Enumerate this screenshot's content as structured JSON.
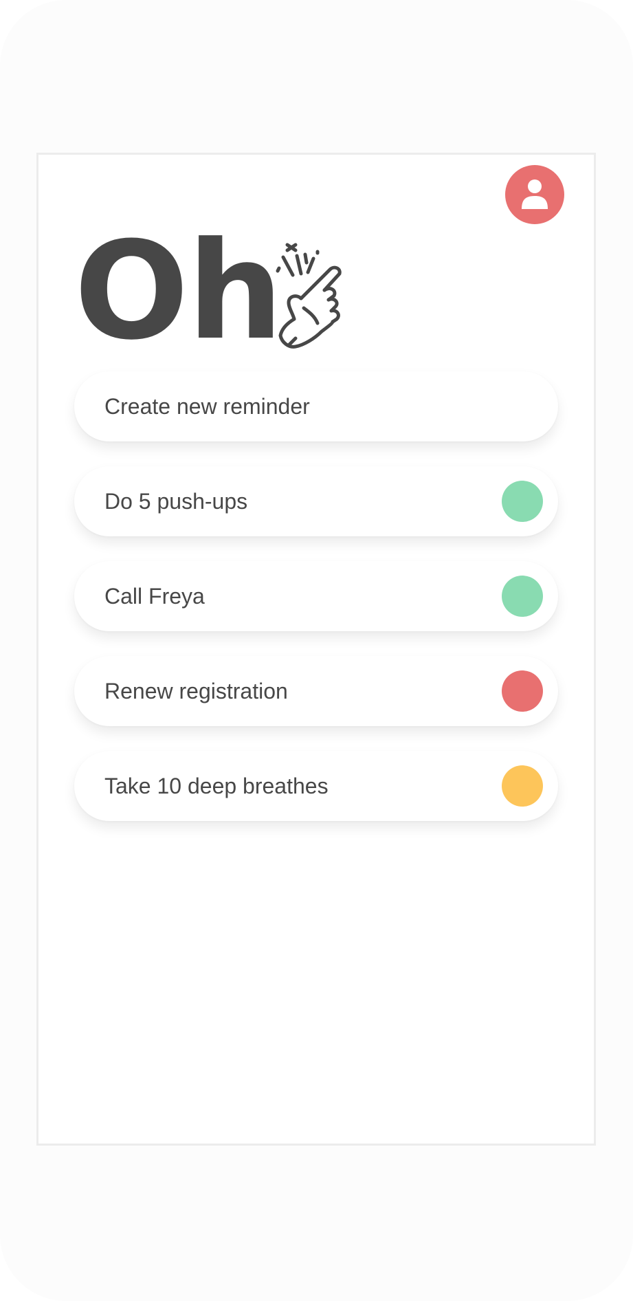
{
  "header": {
    "title": "Oh",
    "profile_icon": "user-icon",
    "profile_color": "#e87070",
    "hero_icon": "finger-snap-icon"
  },
  "create_reminder": {
    "label": "Create new reminder"
  },
  "reminders": [
    {
      "label": "Do 5 push-ups",
      "status_color": "#89dbb1"
    },
    {
      "label": "Call Freya",
      "status_color": "#89dbb1"
    },
    {
      "label": "Renew registration",
      "status_color": "#e87070"
    },
    {
      "label": "Take 10 deep breathes",
      "status_color": "#fdc55a"
    }
  ],
  "colors": {
    "text": "#474747",
    "background": "#ffffff",
    "frame": "#fcfcfc"
  }
}
